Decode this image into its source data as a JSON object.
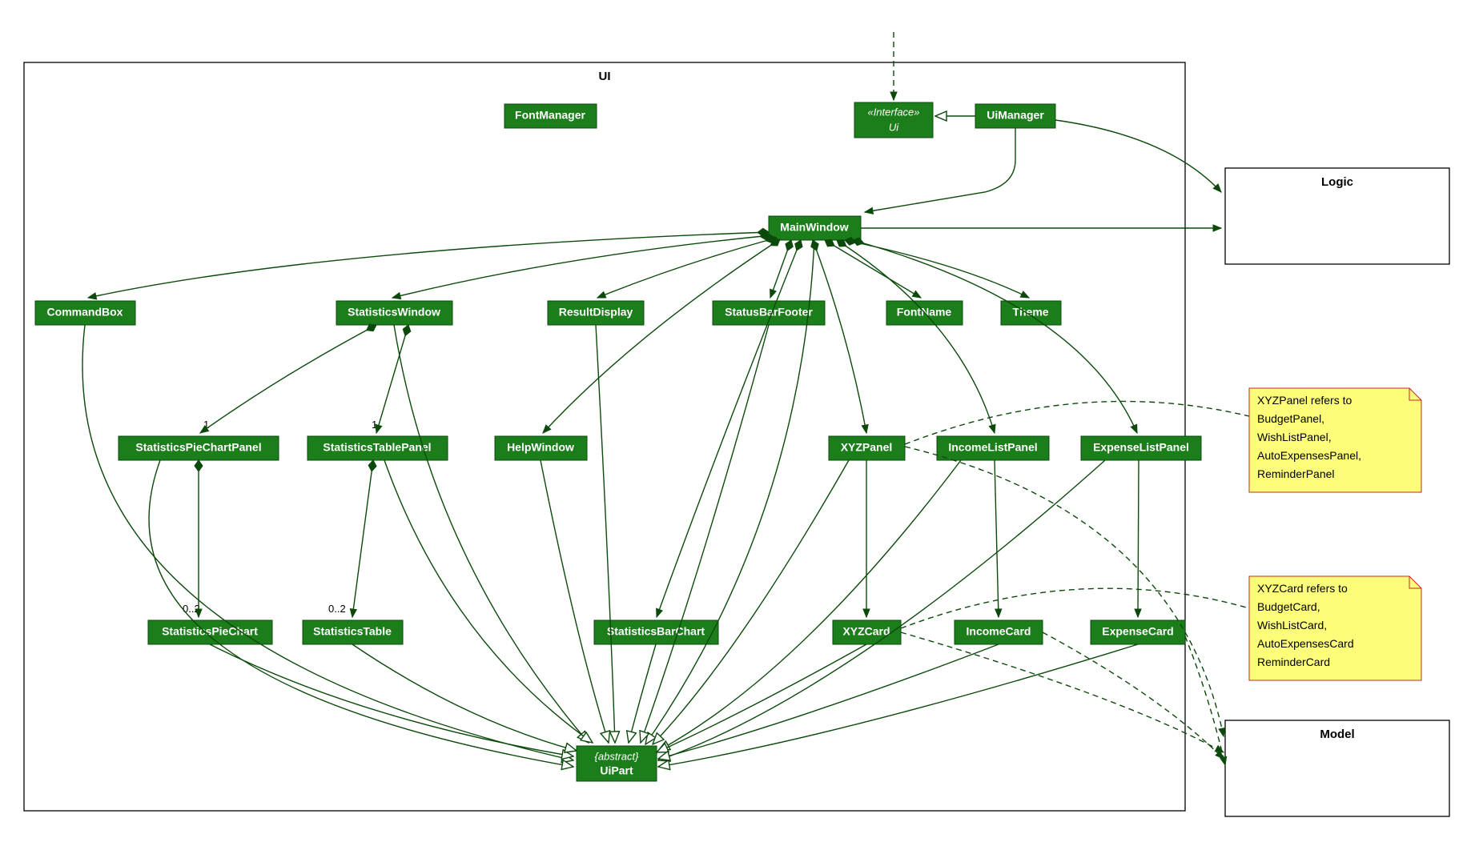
{
  "packages": {
    "ui_label": "UI",
    "logic_label": "Logic",
    "model_label": "Model"
  },
  "classes": {
    "fontManager": "FontManager",
    "uiInterface_stereo": "«Interface»",
    "uiInterface_name": "Ui",
    "uiManager": "UiManager",
    "mainWindow": "MainWindow",
    "commandBox": "CommandBox",
    "statisticsWindow": "StatisticsWindow",
    "resultDisplay": "ResultDisplay",
    "statusBarFooter": "StatusBarFooter",
    "fontName": "FontName",
    "theme": "Theme",
    "statisticsPieChartPanel": "StatisticsPieChartPanel",
    "statisticsTablePanel": "StatisticsTablePanel",
    "helpWindow": "HelpWindow",
    "xyzPanel": "XYZPanel",
    "incomeListPanel": "IncomeListPanel",
    "expenseListPanel": "ExpenseListPanel",
    "statisticsPieChart": "StatisticsPieChart",
    "statisticsTable": "StatisticsTable",
    "statisticsBarChart": "StatisticsBarChart",
    "xyzCard": "XYZCard",
    "incomeCard": "IncomeCard",
    "expenseCard": "ExpenseCard",
    "uiPart_abstract": "{abstract}",
    "uiPart_name": "UiPart"
  },
  "multiplicities": {
    "pieChartPanel": "1",
    "tablePanel": "1",
    "pieChart": "0..2",
    "table": "0..2"
  },
  "notes": {
    "xyzPanel": {
      "l1": "XYZPanel refers to",
      "l2": "BudgetPanel,",
      "l3": "WishListPanel,",
      "l4": "AutoExpensesPanel,",
      "l5": "ReminderPanel"
    },
    "xyzCard": {
      "l1": "XYZCard refers to",
      "l2": "BudgetCard,",
      "l3": "WishListCard,",
      "l4": "AutoExpensesCard",
      "l5": "ReminderCard"
    }
  }
}
